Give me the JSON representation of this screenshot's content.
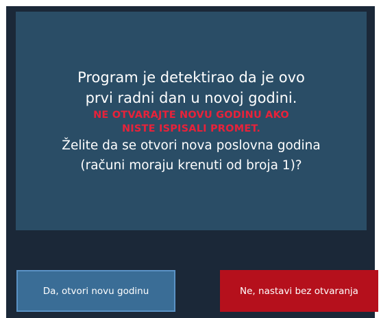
{
  "dialog": {
    "message_lines": [
      "Program je detektirao da je ovo",
      "prvi radni dan u novoj godini."
    ],
    "warning_lines": [
      "NE OTVARAJTE NOVU GODINU AKO",
      "NISTE ISPISALI PROMET."
    ],
    "question_lines": [
      "Želite da se otvori nova poslovna godina",
      "(računi moraju krenuti od broja 1)?"
    ]
  },
  "buttons": {
    "yes_label": "Da, otvori novu godinu",
    "no_label": "Ne, nastavi bez otvaranja"
  },
  "colors": {
    "dialog_background": "#1b2838",
    "panel_background": "#2a4d66",
    "warning_text": "#e8223a",
    "yes_button": "#3a6d96",
    "no_button": "#b5101c"
  }
}
